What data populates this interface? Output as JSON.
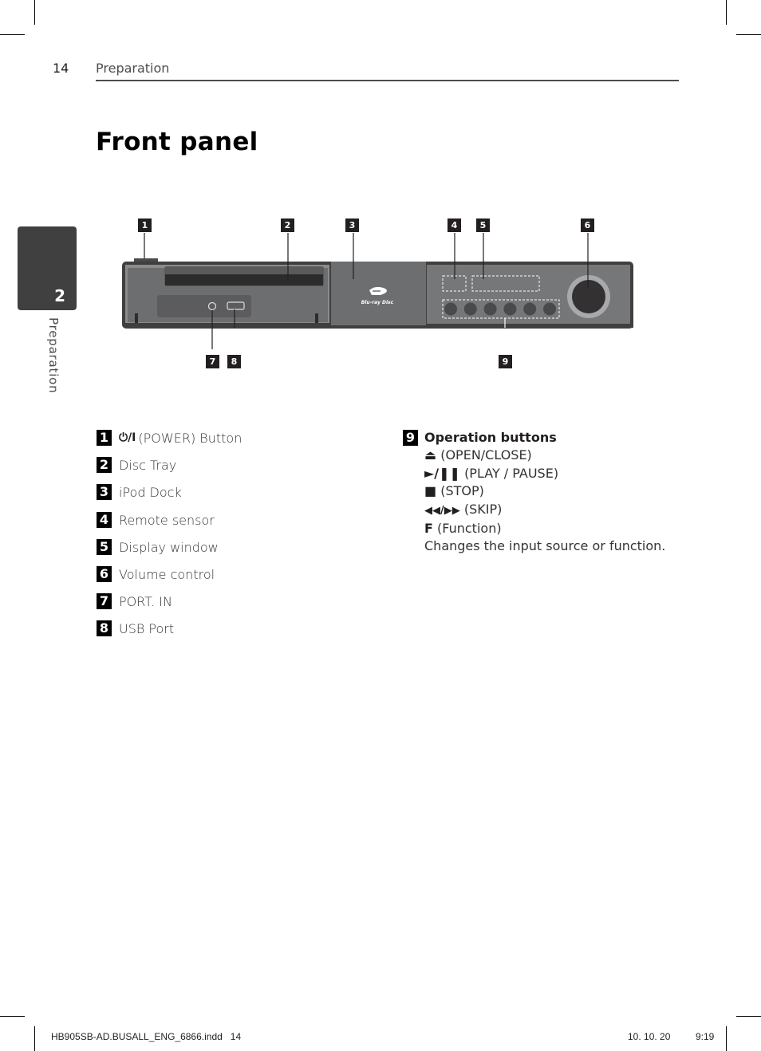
{
  "header": {
    "page_number": "14",
    "section": "Preparation"
  },
  "side_tab": {
    "chapter_number": "2",
    "label": "Preparation"
  },
  "title": "Front panel",
  "diagram": {
    "callouts_top": [
      "1",
      "2",
      "3",
      "4",
      "5",
      "6"
    ],
    "callouts_bottom": [
      "7",
      "8",
      "9"
    ],
    "logo_text": "Blu-ray Disc",
    "colors": {
      "body": "#6d6e70",
      "body_dark": "#3f3f40",
      "knob_ring": "#a7a9ab",
      "knob": "#333132",
      "button": "#4a4a4b"
    }
  },
  "parts": [
    {
      "num": "1",
      "icon": "power-icon",
      "symbol": "⏻/I",
      "label": "(POWER) Button"
    },
    {
      "num": "2",
      "label": "Disc Tray"
    },
    {
      "num": "3",
      "label": "iPod Dock"
    },
    {
      "num": "4",
      "label": "Remote sensor"
    },
    {
      "num": "5",
      "label": "Display window"
    },
    {
      "num": "6",
      "label": "Volume control"
    },
    {
      "num": "7",
      "label": "PORT. IN"
    },
    {
      "num": "8",
      "label": "USB Port"
    }
  ],
  "operation": {
    "num": "9",
    "heading": "Operation buttons",
    "items": [
      {
        "symbol": "⏏",
        "icon": "eject-icon",
        "label": "(OPEN/CLOSE)"
      },
      {
        "symbol": "►/❚❚",
        "icon": "play-pause-icon",
        "label": "(PLAY / PAUSE)"
      },
      {
        "symbol": "■",
        "icon": "stop-icon",
        "label": "(STOP)"
      },
      {
        "symbol": "◀◀/▶▶",
        "icon": "skip-icon",
        "label": "(SKIP)"
      },
      {
        "symbol": "F",
        "icon": "function-icon",
        "label": "(Function)"
      }
    ],
    "description": "Changes the input source or function."
  },
  "footer": {
    "filename": "HB905SB-AD.BUSALL_ENG_6866.indd   14",
    "date": "10. 10. 20",
    "time": "9:19"
  }
}
